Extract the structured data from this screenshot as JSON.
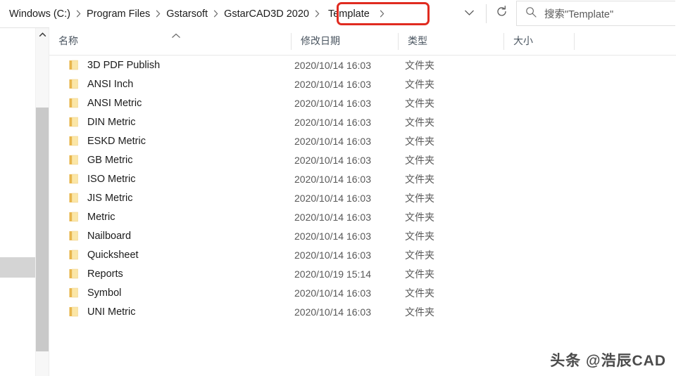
{
  "addressbar": {
    "breadcrumb": {
      "name": "breadcrumb",
      "separator": "›",
      "crumbs": [
        {
          "label": "Windows (C:)"
        },
        {
          "label": "Program Files"
        },
        {
          "label": "Gstarsoft"
        },
        {
          "label": "GstarCAD3D 2020"
        },
        {
          "label": "Template"
        }
      ],
      "highlighted_crumb": "Template",
      "highlight_color": "#e02b20"
    },
    "dropdown_icon": "chevron-down-icon",
    "refresh_icon": "refresh-icon",
    "search": {
      "icon": "search-icon",
      "placeholder": "搜索\"Template\"",
      "value": ""
    }
  },
  "columns": {
    "headers": [
      {
        "label": "名称",
        "key": "name"
      },
      {
        "label": "修改日期",
        "key": "date"
      },
      {
        "label": "类型",
        "key": "type"
      },
      {
        "label": "大小",
        "key": "size"
      }
    ],
    "sort_column": "名称",
    "sort_direction": "ascending",
    "sort_indicator_icon": "chevron-up-icon"
  },
  "files": [
    {
      "name": "3D PDF Publish",
      "date": "2020/10/14 16:03",
      "type": "文件夹",
      "size": "",
      "icon": "folder-icon"
    },
    {
      "name": "ANSI Inch",
      "date": "2020/10/14 16:03",
      "type": "文件夹",
      "size": "",
      "icon": "folder-icon"
    },
    {
      "name": "ANSI Metric",
      "date": "2020/10/14 16:03",
      "type": "文件夹",
      "size": "",
      "icon": "folder-icon"
    },
    {
      "name": "DIN Metric",
      "date": "2020/10/14 16:03",
      "type": "文件夹",
      "size": "",
      "icon": "folder-icon"
    },
    {
      "name": "ESKD Metric",
      "date": "2020/10/14 16:03",
      "type": "文件夹",
      "size": "",
      "icon": "folder-icon"
    },
    {
      "name": "GB Metric",
      "date": "2020/10/14 16:03",
      "type": "文件夹",
      "size": "",
      "icon": "folder-icon"
    },
    {
      "name": "ISO Metric",
      "date": "2020/10/14 16:03",
      "type": "文件夹",
      "size": "",
      "icon": "folder-icon"
    },
    {
      "name": "JIS Metric",
      "date": "2020/10/14 16:03",
      "type": "文件夹",
      "size": "",
      "icon": "folder-icon"
    },
    {
      "name": "Metric",
      "date": "2020/10/14 16:03",
      "type": "文件夹",
      "size": "",
      "icon": "folder-icon"
    },
    {
      "name": "Nailboard",
      "date": "2020/10/14 16:03",
      "type": "文件夹",
      "size": "",
      "icon": "folder-icon"
    },
    {
      "name": "Quicksheet",
      "date": "2020/10/14 16:03",
      "type": "文件夹",
      "size": "",
      "icon": "folder-icon"
    },
    {
      "name": "Reports",
      "date": "2020/10/19 15:14",
      "type": "文件夹",
      "size": "",
      "icon": "folder-icon"
    },
    {
      "name": "Symbol",
      "date": "2020/10/14 16:03",
      "type": "文件夹",
      "size": "",
      "icon": "folder-icon"
    },
    {
      "name": "UNI Metric",
      "date": "2020/10/14 16:03",
      "type": "文件夹",
      "size": "",
      "icon": "folder-icon"
    }
  ],
  "scrollbar": {
    "up_arrow_icon": "chevron-up-icon",
    "orientation": "vertical"
  },
  "watermark": {
    "text": "头条 @浩辰CAD"
  }
}
